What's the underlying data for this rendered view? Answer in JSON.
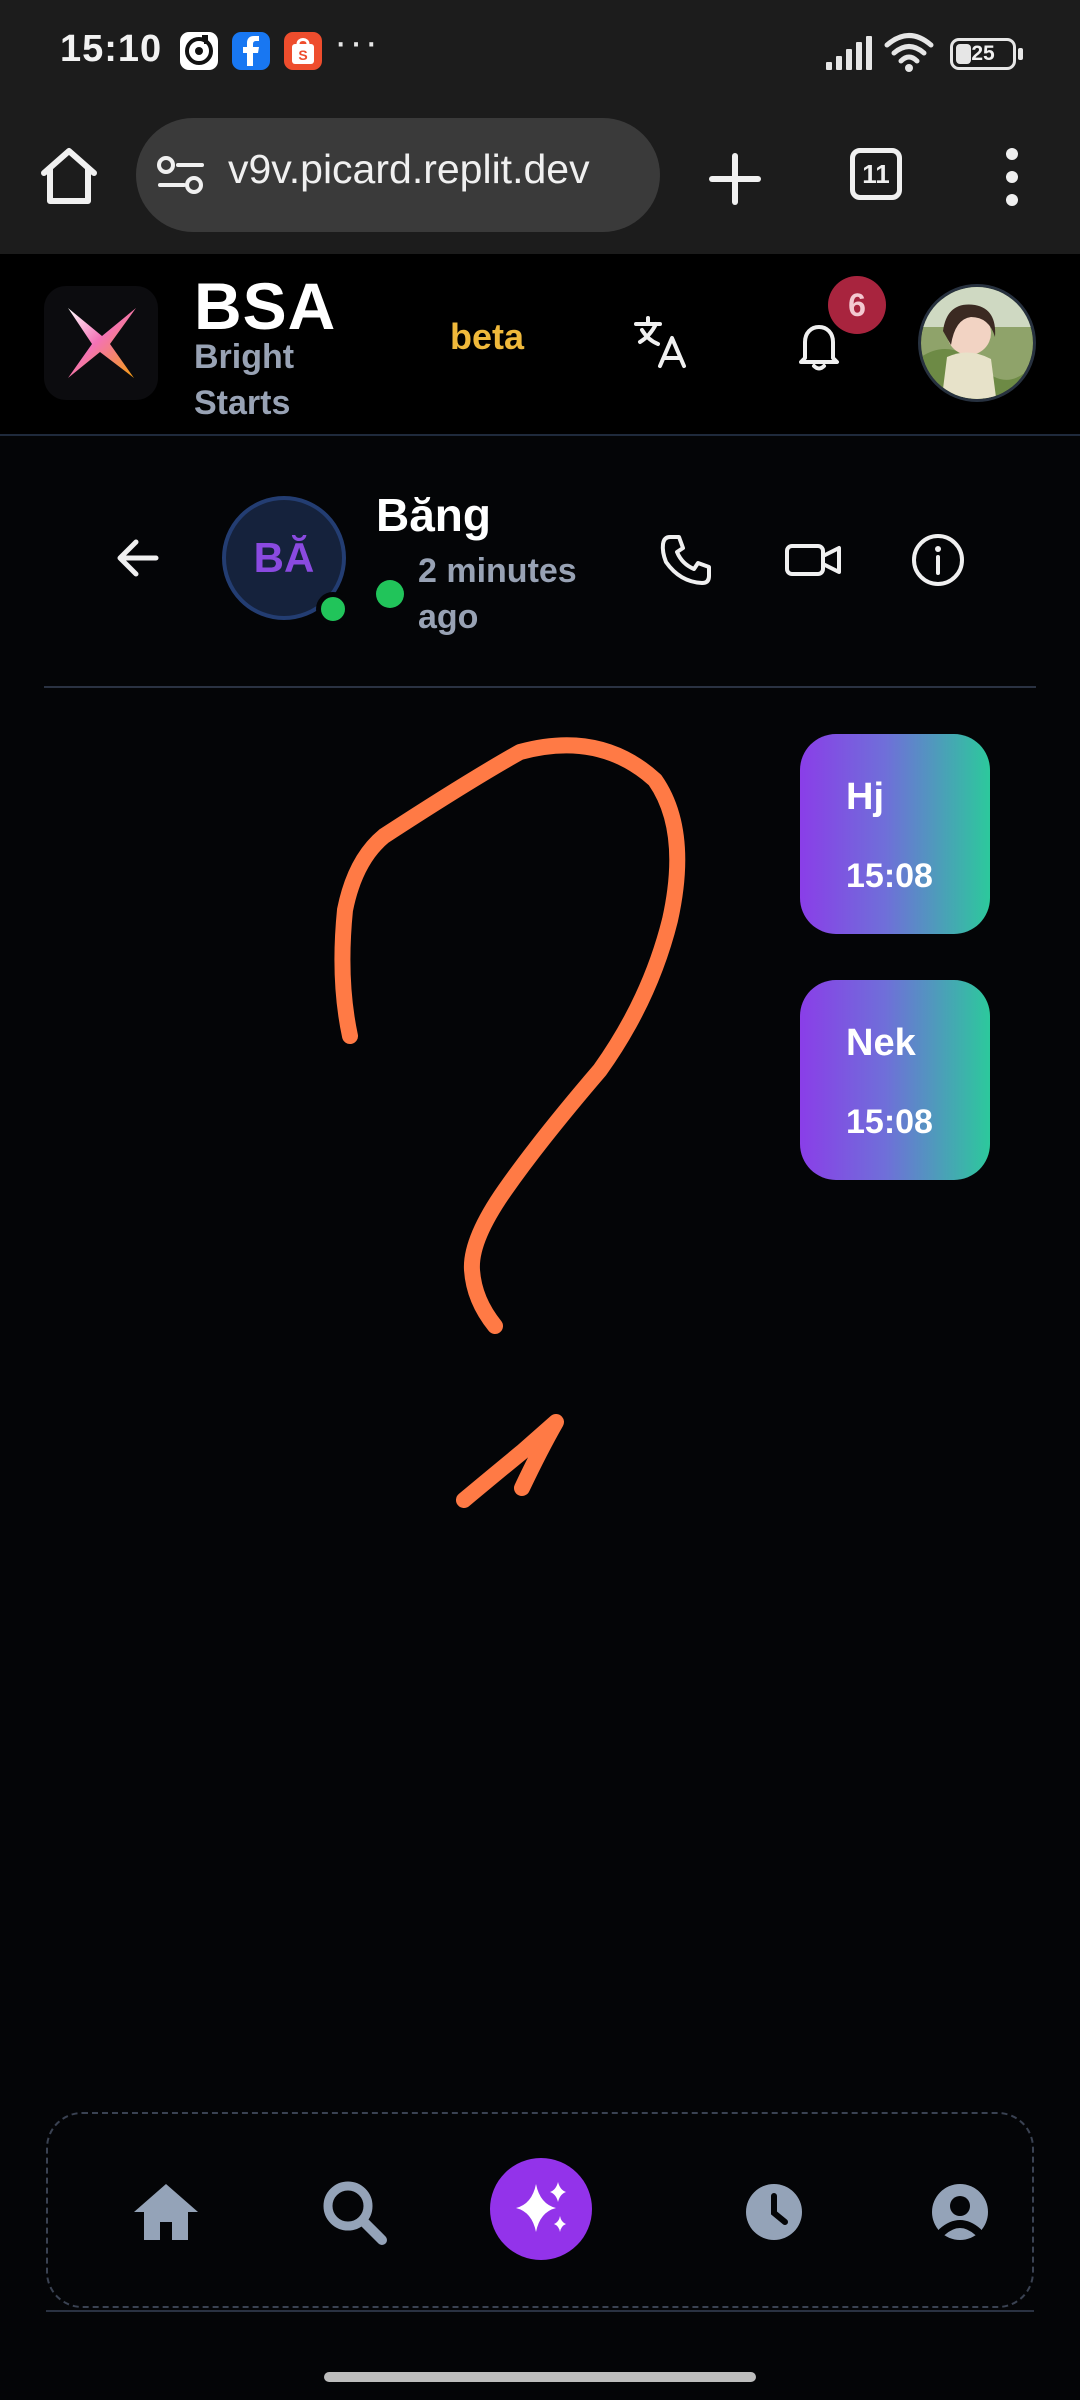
{
  "status_bar": {
    "time": "15:10",
    "more_notifications": "···",
    "battery_level": "25",
    "notification_icons": [
      "tiktok-icon",
      "facebook-icon",
      "shopee-icon"
    ]
  },
  "browser": {
    "url": "v9v.picard.replit.dev",
    "tab_count": "11"
  },
  "app_header": {
    "brand": "BSA",
    "brand_sub_line1": "Bright",
    "brand_sub_line2": "Starts",
    "beta_label": "beta",
    "notification_count": "6"
  },
  "chat": {
    "contact_initials": "BĂ",
    "contact_name": "Băng",
    "last_seen": "2 minutes ago",
    "messages": [
      {
        "text": "Hj",
        "time": "15:08"
      },
      {
        "text": "Nek",
        "time": "15:08"
      }
    ]
  },
  "bottom_nav": {
    "items": [
      "home",
      "search",
      "ai-sparkle",
      "history",
      "profile"
    ],
    "active": "ai-sparkle"
  },
  "colors": {
    "accent": "#9333ea",
    "online": "#21c45a",
    "beta": "#f0b93b",
    "badge": "#a8243e",
    "annotation": "#ff7a45"
  }
}
